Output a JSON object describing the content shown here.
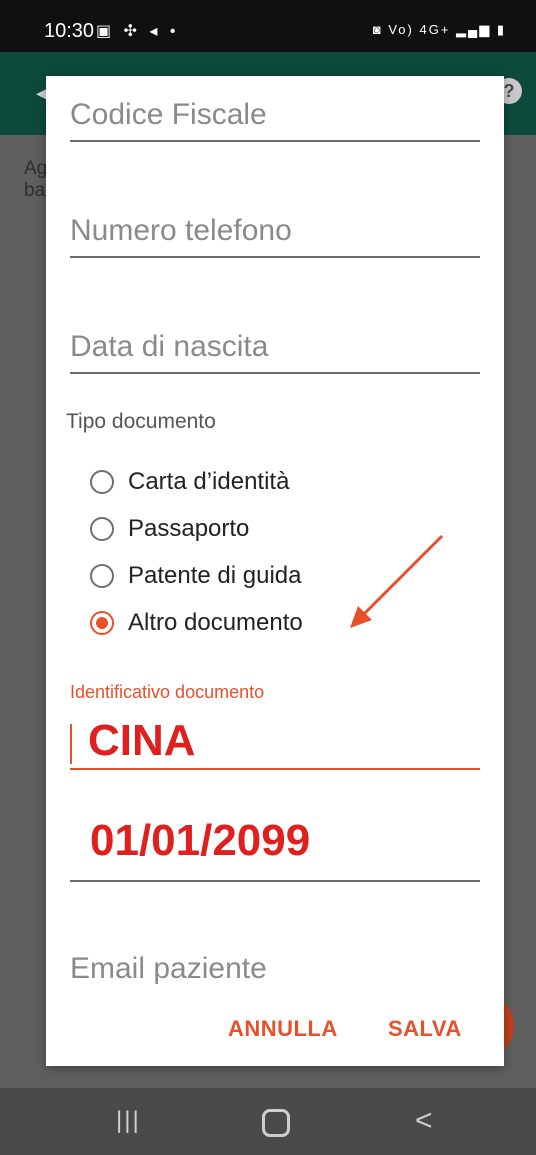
{
  "status_bar": {
    "time": "10:30",
    "left_icons": "▣ ✣ ◂ •",
    "right_icons": "◙ Vo) 4G+ ▂▄▆ ▮"
  },
  "background": {
    "text": "Ag\nba"
  },
  "dialog": {
    "fields": {
      "codice_fiscale_placeholder": "Codice Fiscale",
      "telefono_placeholder": "Numero telefono",
      "data_nascita_placeholder": "Data di nascita",
      "tipo_documento_label": "Tipo documento",
      "radio_options": [
        {
          "label": "Carta d’identità",
          "checked": false
        },
        {
          "label": "Passaporto",
          "checked": false
        },
        {
          "label": "Patente di guida",
          "checked": false
        },
        {
          "label": "Altro documento",
          "checked": true
        }
      ],
      "identificativo_label": "Identificativo documento",
      "identificativo_value": "CINA",
      "scadenza_value": "01/01/2099",
      "email_placeholder": "Email paziente"
    },
    "actions": {
      "cancel_label": "ANNULLA",
      "save_label": "SALVA"
    }
  },
  "colors": {
    "accent": "#e8502a",
    "value_red": "#e01f1f",
    "appbar": "#0c4b3b"
  }
}
